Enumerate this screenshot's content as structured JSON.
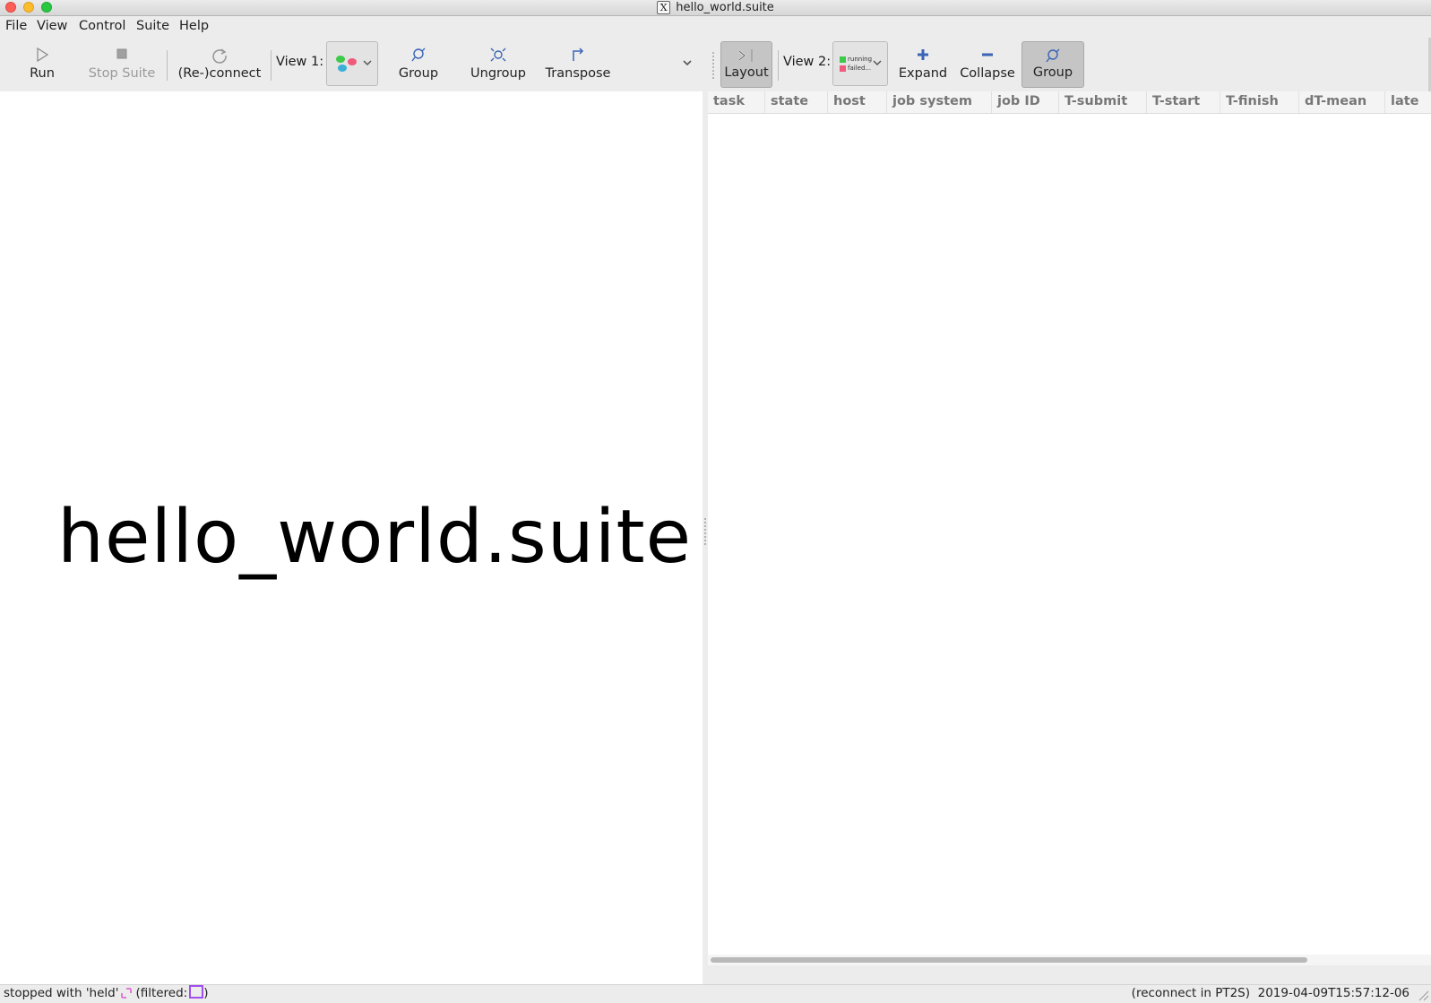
{
  "window": {
    "title": "hello_world.suite"
  },
  "menu": [
    "File",
    "View",
    "Control",
    "Suite",
    "Help"
  ],
  "toolbar": {
    "run": "Run",
    "stop": "Stop Suite",
    "reconnect": "(Re-)connect",
    "view1_label": "View 1:",
    "group": "Group",
    "ungroup": "Ungroup",
    "transpose": "Transpose",
    "layout": "Layout",
    "view2_label": "View 2:",
    "legend_running": "running",
    "legend_failed": "failed...",
    "expand": "Expand",
    "collapse": "Collapse",
    "group2": "Group"
  },
  "left_panel": {
    "suite_name": "hello_world.suite"
  },
  "table": {
    "columns": [
      "task",
      "state",
      "host",
      "job system",
      "job ID",
      "T-submit",
      "T-start",
      "T-finish",
      "dT-mean",
      "late"
    ]
  },
  "status": {
    "left_text": "stopped with 'held'",
    "filtered_label": "(filtered:",
    "filtered_close": ")",
    "reconnect": "(reconnect in PT2S)",
    "timestamp": "2019-04-09T15:57:12-06"
  },
  "colors": {
    "accent_blue": "#3a64b5",
    "running_green": "#3dc94a",
    "failed_pink": "#f0597a",
    "filter_purple": "#a24ff0"
  }
}
